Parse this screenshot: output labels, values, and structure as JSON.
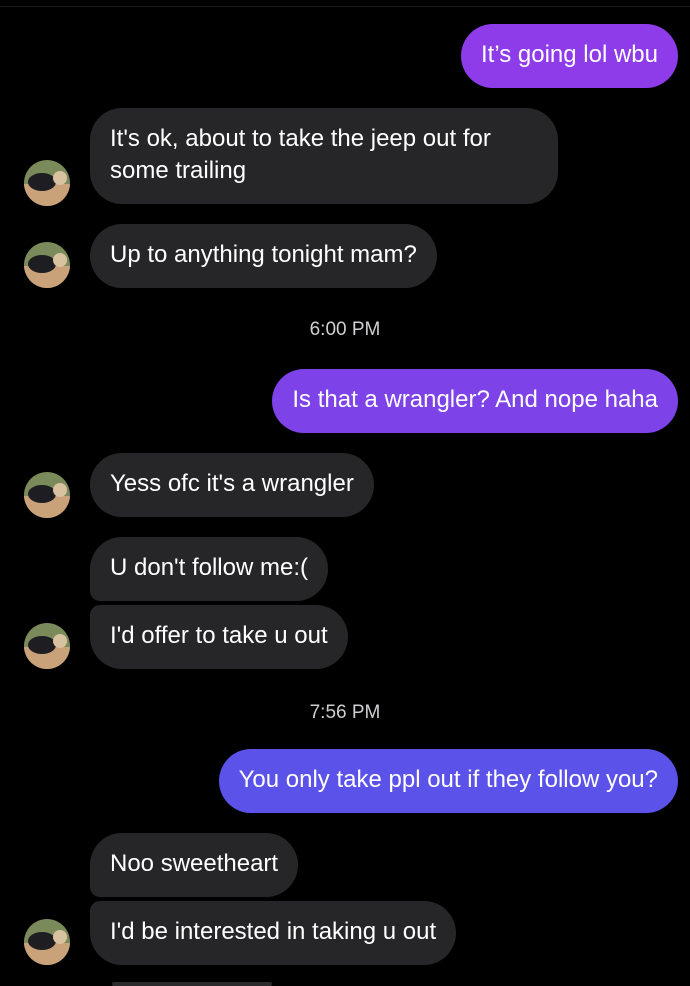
{
  "messages": {
    "m1": "It’s going lol wbu",
    "m2_line1": "It's ok, about to take the jeep out for",
    "m2_line2": "some trailing",
    "m3": "Up to anything tonight mam?",
    "ts1": "6:00 PM",
    "m4": "Is that a wrangler? And nope haha",
    "m5": "Yess ofc it's a wrangler",
    "m6": "U don't follow me:(",
    "m7": "I'd offer to take u out",
    "ts2": "7:56 PM",
    "m8": "You only take ppl out if they follow you?",
    "m9": "Noo sweetheart",
    "m10": "I'd be interested in taking u out"
  },
  "colors": {
    "incoming_bubble": "#262628",
    "outgoing_top": "#8e3bea",
    "outgoing_mid": "#7d42e8",
    "outgoing_bottom": "#5b52e9",
    "background": "#000000"
  },
  "icons": {
    "avatar": "contact-avatar-icon"
  }
}
